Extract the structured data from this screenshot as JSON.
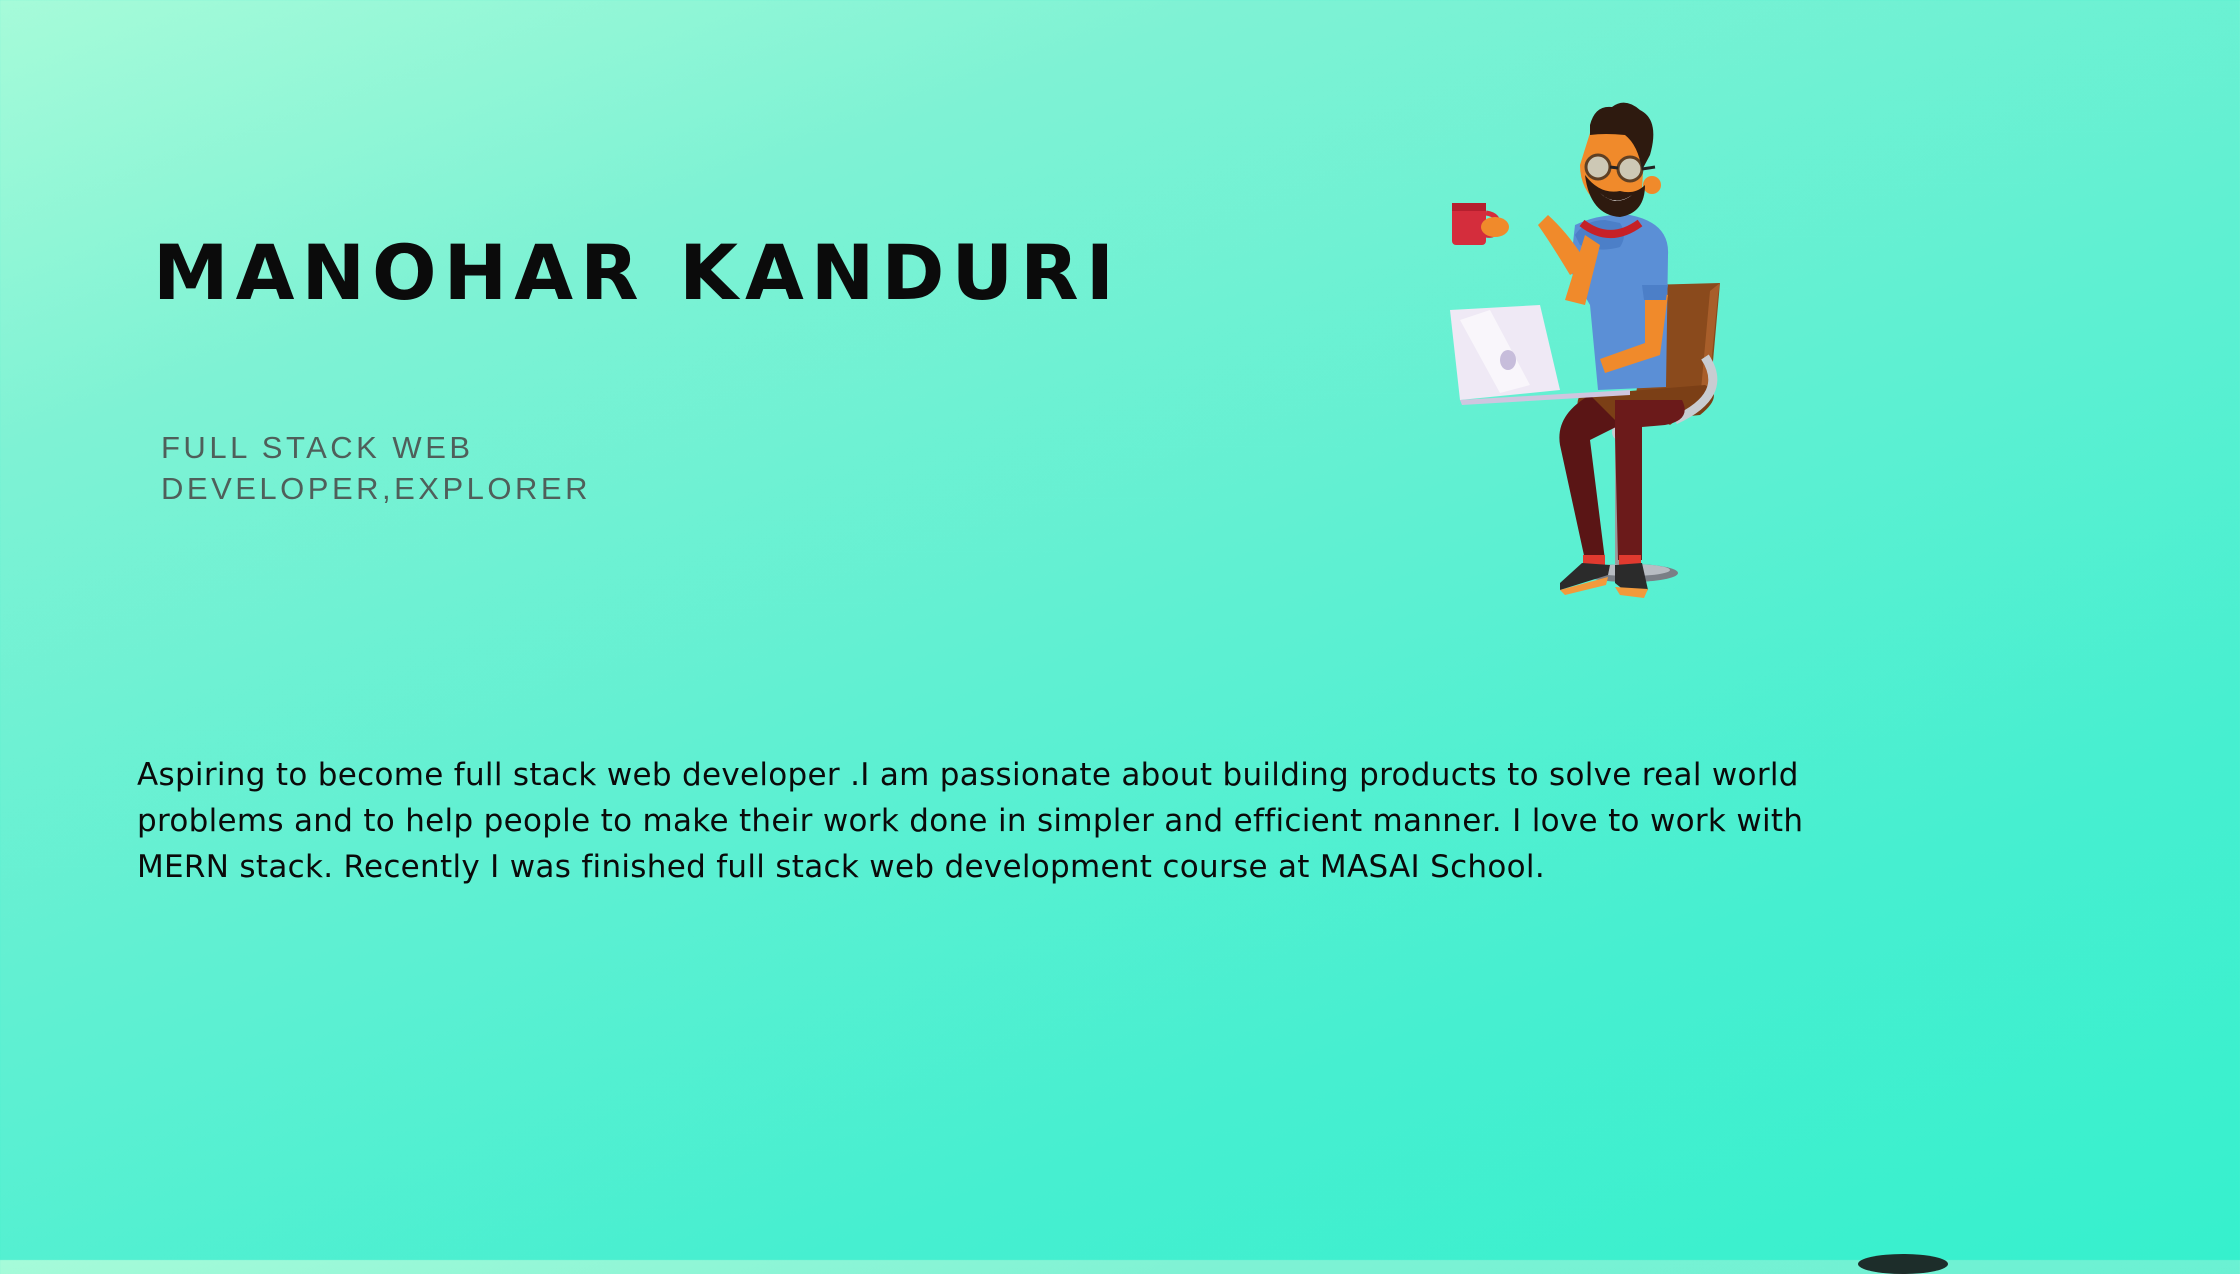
{
  "profile": {
    "name": "MANOHAR KANDURI",
    "role": "FULL STACK WEB DEVELOPER,EXPLORER",
    "bio": "Aspiring to become full stack web developer .I am passionate about building products to solve real world problems and to help people to make their work done in simpler and efficient manner. I love to work with  MERN stack. Recently I was finished full stack web development course at MASAI School."
  },
  "illustration": {
    "icon": "developer-with-laptop-and-coffee-illustration"
  },
  "colors": {
    "background_start": "#a6fbd9",
    "background_end": "#36f0cd",
    "text_primary": "#0b0b0b",
    "text_secondary": "#4f5f5a"
  }
}
